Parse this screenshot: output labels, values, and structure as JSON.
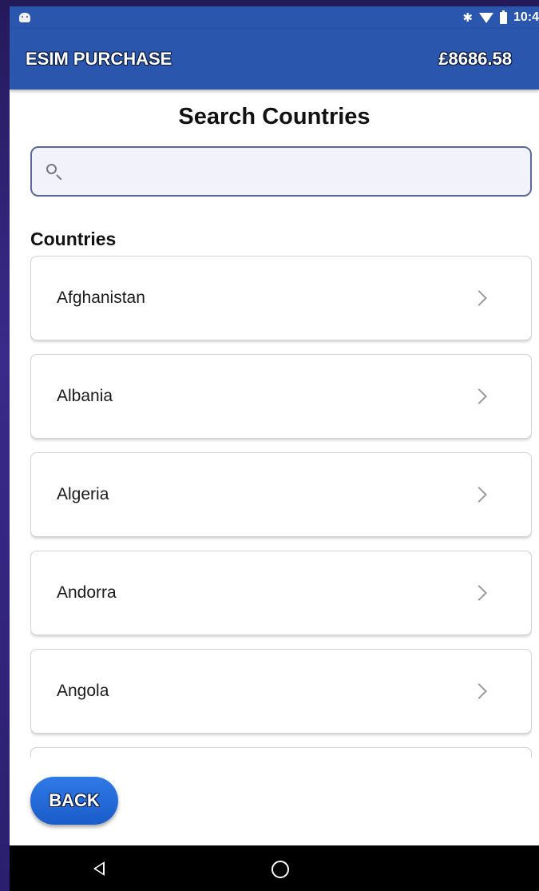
{
  "status_bar": {
    "time": "10:4"
  },
  "app_bar": {
    "title": "ESIM PURCHASE",
    "balance": "£8686.58"
  },
  "page": {
    "heading": "Search Countries"
  },
  "search": {
    "value": "",
    "placeholder": ""
  },
  "countries_section": {
    "label": "Countries",
    "items": [
      {
        "label": "Afghanistan"
      },
      {
        "label": "Albania"
      },
      {
        "label": "Algeria"
      },
      {
        "label": "Andorra"
      },
      {
        "label": "Angola"
      }
    ]
  },
  "back_button": {
    "label": "BACK"
  },
  "colors": {
    "primary": "#2a56ad",
    "button": "#1f66d6"
  }
}
